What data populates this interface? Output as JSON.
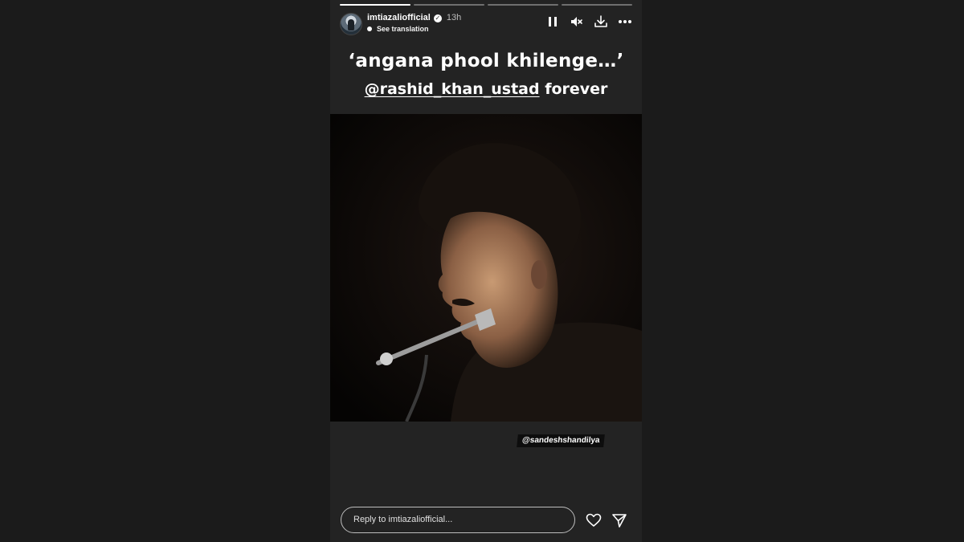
{
  "story": {
    "progress_segments": [
      1,
      0,
      0,
      0
    ],
    "user": {
      "username": "imtiazaliofficial",
      "verified_badge_icon": "verified-check-icon",
      "time_ago": "13h",
      "see_translation": "See translation"
    },
    "controls": [
      "pause-icon",
      "mute-icon",
      "download-icon",
      "more-icon"
    ],
    "caption": {
      "line1": "‘angana phool khilenge…’",
      "mention": "@rashid_khan_ustad",
      "suffix": " forever"
    },
    "photo_credit": "@sandeshshandilya",
    "reply_placeholder": "Reply to imtiazaliofficial...",
    "actions": [
      "heart-icon",
      "send-icon"
    ]
  }
}
